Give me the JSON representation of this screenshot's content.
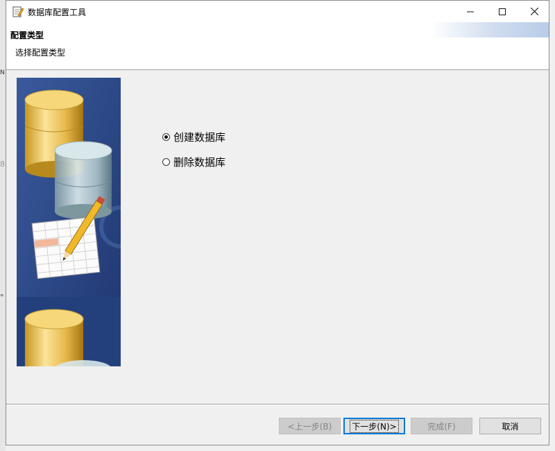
{
  "window": {
    "title": "数据库配置工具",
    "icon": "database-config-icon",
    "controls": [
      "minimize-icon",
      "maximize-icon",
      "close-icon"
    ]
  },
  "header": {
    "title": "配置类型",
    "subtitle": "选择配置类型"
  },
  "options": [
    {
      "label": "创建数据库",
      "selected": true
    },
    {
      "label": "删除数据库",
      "selected": false
    }
  ],
  "buttons": {
    "prev": {
      "label": "<上一步(B)",
      "enabled": false
    },
    "next": {
      "label": "下一步(N)>",
      "enabled": true,
      "default": true
    },
    "finish": {
      "label": "完成(F)",
      "enabled": false
    },
    "cancel": {
      "label": "取消",
      "enabled": true
    }
  },
  "colors": {
    "illustration_bg": "#2d4a86",
    "focus_border": "#0078d7"
  }
}
